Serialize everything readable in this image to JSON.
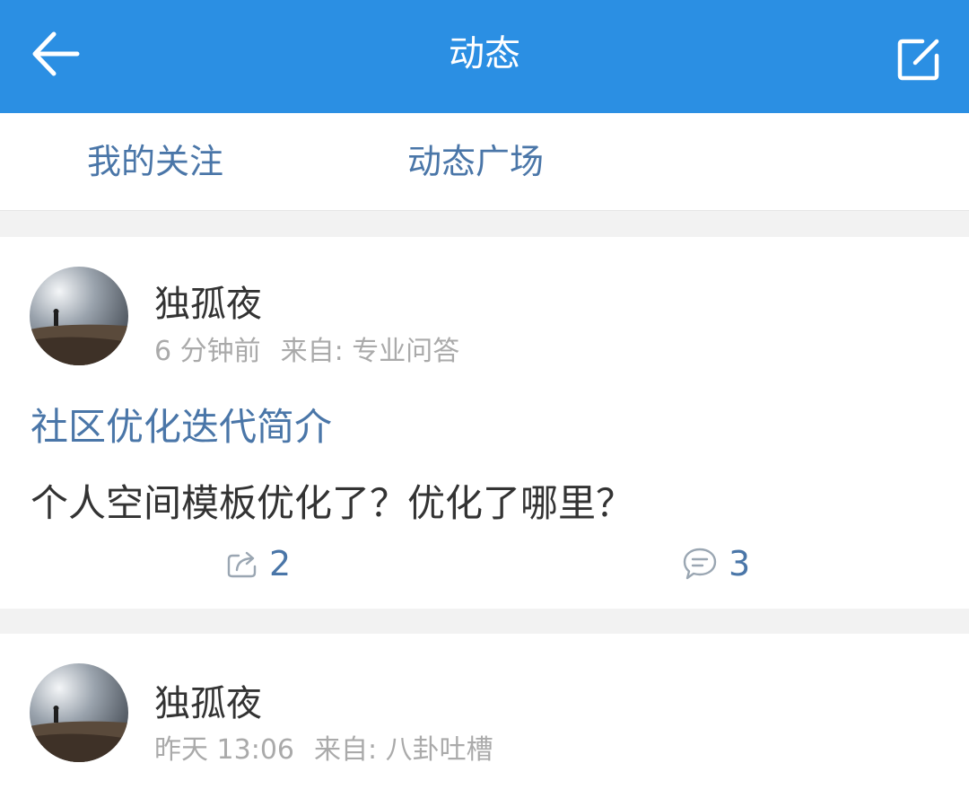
{
  "header": {
    "title": "动态",
    "back_icon": "arrow-left-icon",
    "compose_icon": "edit-icon"
  },
  "tabs": [
    {
      "label": "我的关注"
    },
    {
      "label": "动态广场"
    }
  ],
  "posts": [
    {
      "author": "独孤夜",
      "time": "6 分钟前",
      "source": "来自: 专业问答",
      "title": "社区优化迭代简介",
      "body": "个人空间模板优化了？优化了哪里？",
      "shares": "2",
      "comments": "3"
    },
    {
      "author": "独孤夜",
      "time": "昨天 13:06",
      "source": "来自: 八卦吐槽"
    }
  ],
  "colors": {
    "header_bg": "#2b8fe3",
    "link": "#4a76a8",
    "meta": "#aaaaaa"
  }
}
